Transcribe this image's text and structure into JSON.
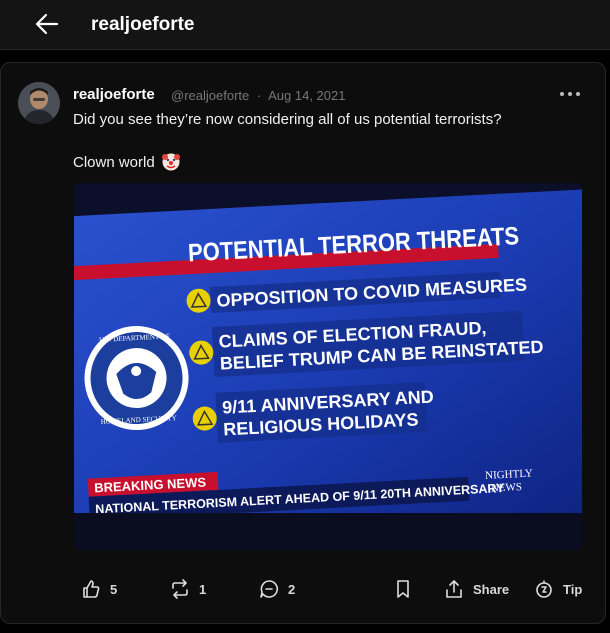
{
  "header": {
    "title": "realjoeforte"
  },
  "post": {
    "author_name": "realjoeforte",
    "handle": "@realjoeforte",
    "separator": "·",
    "date": "Aug 14, 2021",
    "text_line1": "Did you see they’re now considering all of us potential terrorists?",
    "text_line2": "Clown world"
  },
  "media": {
    "headline": "POTENTIAL TERROR THREATS",
    "items": [
      {
        "line1": "OPPOSITION TO COVID MEASURES",
        "line2": ""
      },
      {
        "line1": "CLAIMS OF ELECTION FRAUD,",
        "line2": "BELIEF TRUMP CAN BE REINSTATED"
      },
      {
        "line1": "9/11 ANNIVERSARY AND",
        "line2": "RELIGIOUS HOLIDAYS"
      }
    ],
    "breaking_label": "BREAKING NEWS",
    "ticker": "NATIONAL TERRORISM ALERT AHEAD OF 9/11 20TH ANNIVERSARY",
    "network_line1": "NIGHTLY",
    "network_line2": "NEWS",
    "seal_text_top": "U.S. DEPARTMENT OF",
    "seal_text_bottom": "HOMELAND SECURITY"
  },
  "actions": {
    "likes": "5",
    "reposts": "1",
    "comments": "2",
    "share_label": "Share",
    "tip_label": "Tip"
  },
  "colors": {
    "background": "#000000",
    "card": "#0d0d0d",
    "screen_blue": "#1c3fb0",
    "headline_red": "#c8102e",
    "warning_yellow": "#e8d000"
  }
}
